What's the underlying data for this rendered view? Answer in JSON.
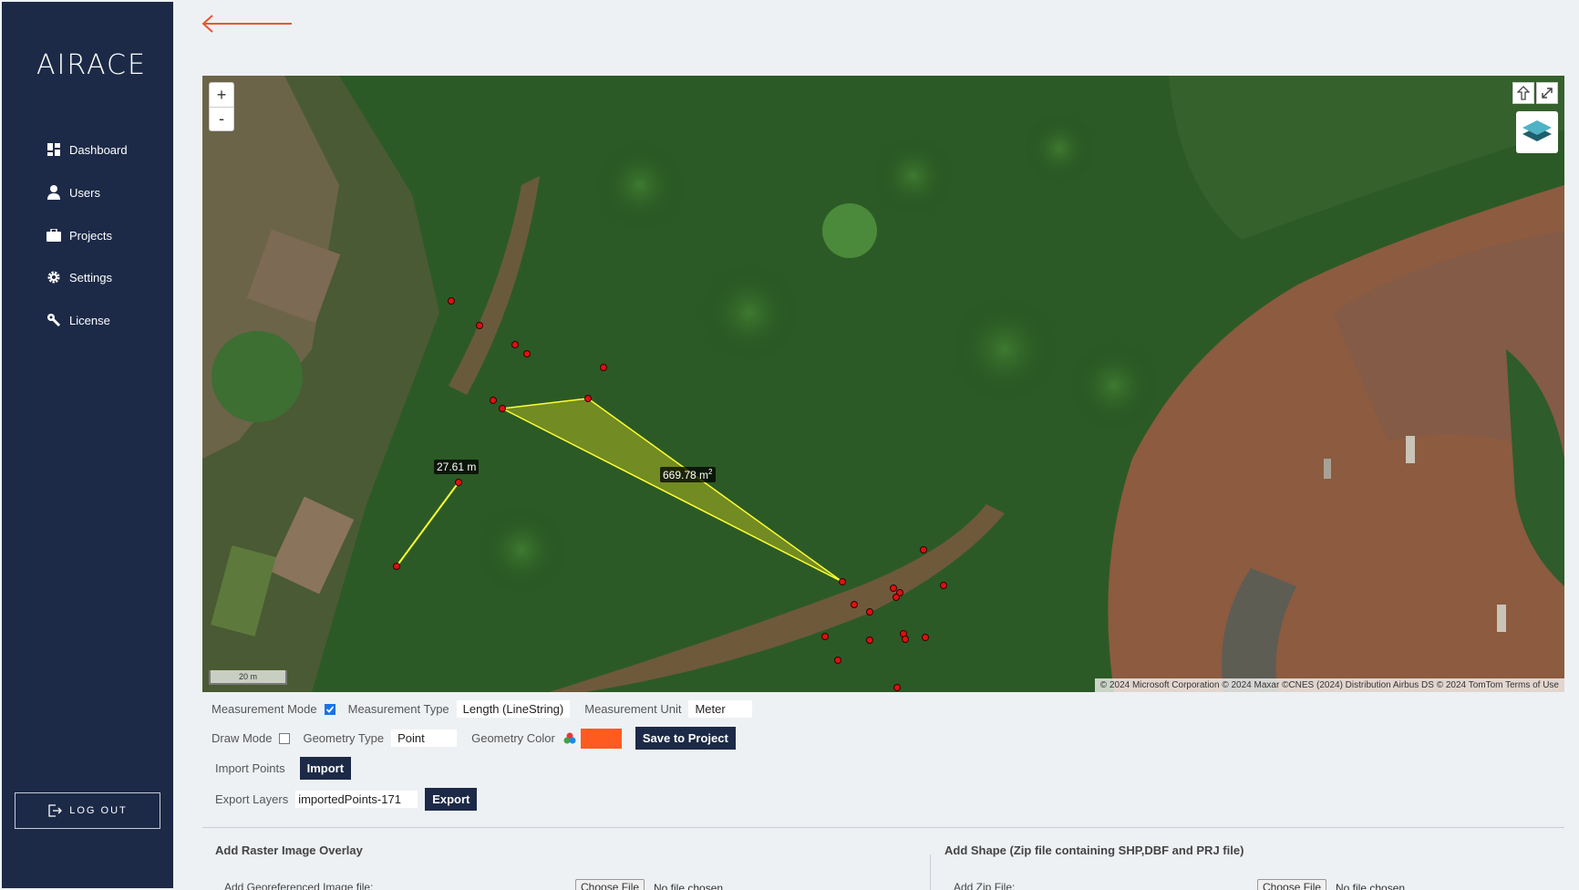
{
  "app": {
    "logo": "AIRACE"
  },
  "sidebar": {
    "items": [
      {
        "label": "Dashboard"
      },
      {
        "label": "Users"
      },
      {
        "label": "Projects"
      },
      {
        "label": "Settings"
      },
      {
        "label": "License"
      }
    ],
    "logout_label": "LOG OUT"
  },
  "map": {
    "zoom_in": "+",
    "zoom_out": "-",
    "scale_label": "20 m",
    "attribution": "© 2024 Microsoft Corporation © 2024 Maxar ©CNES (2024) Distribution Airbus DS © 2024 TomTom Terms of Use",
    "line_measurement": "27.61 m",
    "area_measurement": "669.78 m",
    "area_unit_sup": "2"
  },
  "controls": {
    "measurement_mode_label": "Measurement Mode",
    "measurement_mode_checked": true,
    "measurement_type_label": "Measurement Type",
    "measurement_type_value": "Length (LineString)",
    "measurement_unit_label": "Meter",
    "measurement_unit_title": "Measurement Unit",
    "draw_mode_label": "Draw Mode",
    "draw_mode_checked": false,
    "geometry_type_label": "Geometry Type",
    "geometry_type_value": "Point",
    "geometry_color_label": "Geometry Color",
    "geometry_color": "#ff5a1f",
    "save_button": "Save to Project",
    "import_points_label": "Import Points",
    "import_button": "Import",
    "export_layers_label": "Export Layers",
    "export_value": "importedPoints-171",
    "export_button": "Export"
  },
  "raster": {
    "title": "Add Raster Image Overlay",
    "file_label": "Add Georeferenced Image file:",
    "choose": "Choose File",
    "none": "No file chosen"
  },
  "shape": {
    "title": "Add Shape (Zip file containing SHP,DBF and PRJ file)",
    "file_label": "Add Zip File:",
    "choose": "Choose File",
    "none": "No file chosen"
  },
  "colors": {
    "sidebar": "#1c2a47",
    "accent": "#e8572a",
    "measure": "#ffff33"
  }
}
